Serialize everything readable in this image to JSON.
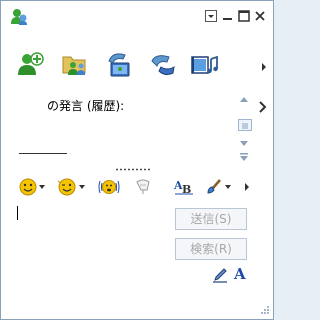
{
  "history": {
    "header_text": "の発言 (履歴):"
  },
  "buttons": {
    "send_label": "送信(S)",
    "search_label": "検索(R)"
  },
  "format": {
    "font_label": "A"
  },
  "toolbar_icons": [
    "invite-contact-icon",
    "share-folder-icon",
    "video-call-icon",
    "voice-call-icon",
    "share-media-icon"
  ],
  "format_icons": [
    "emoticon-icon",
    "wink-icon",
    "nudge-icon",
    "voice-clip-icon",
    "font-style-icon",
    "background-brush-icon"
  ],
  "colors": {
    "border": "#8aa0bb",
    "button_disabled_text": "#a8a8a8",
    "accent_blue": "#1c4aa8",
    "icon_green": "#3aa336"
  }
}
